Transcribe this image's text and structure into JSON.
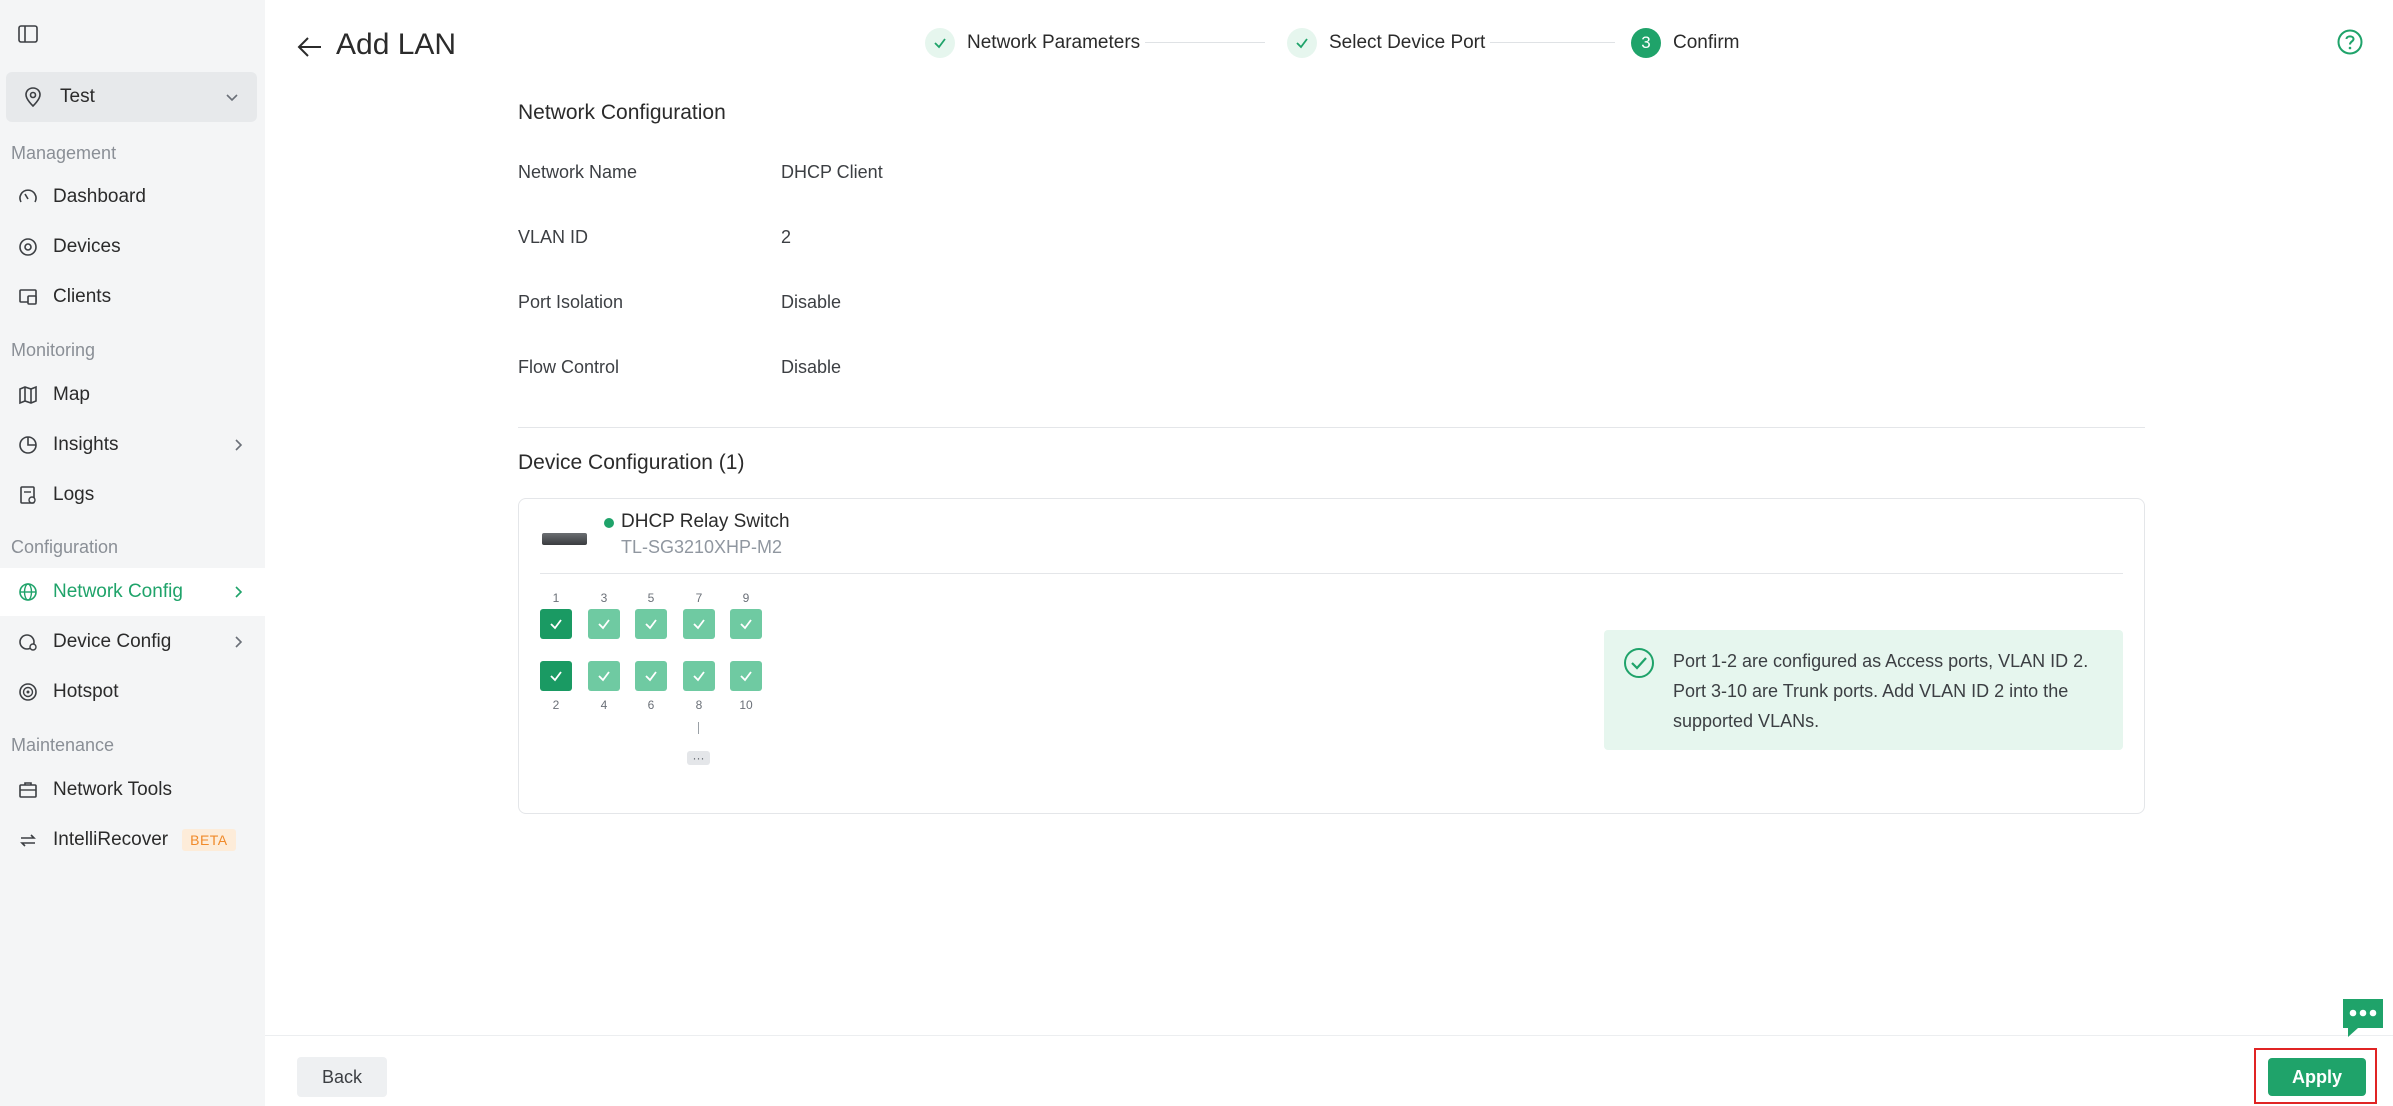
{
  "sidebar": {
    "site": {
      "name": "Test"
    },
    "sections": {
      "management": "Management",
      "monitoring": "Monitoring",
      "configuration": "Configuration",
      "maintenance": "Maintenance"
    },
    "items": {
      "dashboard": "Dashboard",
      "devices": "Devices",
      "clients": "Clients",
      "map": "Map",
      "insights": "Insights",
      "logs": "Logs",
      "network_config": "Network Config",
      "device_config": "Device Config",
      "hotspot": "Hotspot",
      "network_tools": "Network Tools",
      "intellirecover": "IntelliRecover",
      "beta_badge": "BETA"
    },
    "active_item": "Network Config"
  },
  "header": {
    "title": "Add LAN"
  },
  "stepper": {
    "steps": [
      {
        "label": "Network Parameters",
        "state": "done"
      },
      {
        "label": "Select Device Port",
        "state": "done"
      },
      {
        "label": "Confirm",
        "state": "current",
        "number": "3"
      }
    ]
  },
  "network_configuration": {
    "heading": "Network Configuration",
    "fields": [
      {
        "label": "Network Name",
        "value": "DHCP Client"
      },
      {
        "label": "VLAN ID",
        "value": "2"
      },
      {
        "label": "Port Isolation",
        "value": "Disable"
      },
      {
        "label": "Flow Control",
        "value": "Disable"
      }
    ]
  },
  "device_configuration": {
    "heading": "Device Configuration (1)",
    "device": {
      "name": "DHCP Relay Switch",
      "model": "TL-SG3210XHP-M2",
      "status": "online"
    },
    "ports": {
      "top_row": [
        "1",
        "3",
        "5",
        "7",
        "9"
      ],
      "bottom_row": [
        "2",
        "4",
        "6",
        "8",
        "10"
      ],
      "access_ports": [
        "1",
        "2"
      ],
      "trunk_ports": [
        "3",
        "4",
        "5",
        "6",
        "7",
        "8",
        "9",
        "10"
      ],
      "more_label": "···"
    },
    "info_message": "Port 1-2 are configured as Access ports, VLAN ID 2. Port 3-10 are Trunk ports. Add VLAN ID 2 into the supported VLANs."
  },
  "footer": {
    "back_label": "Back",
    "apply_label": "Apply"
  },
  "colors": {
    "accent": "#1fa36a",
    "access_port": "#1a9a63",
    "trunk_port": "#6fcaa2",
    "info_bg": "#e6f6ee",
    "highlight_frame": "#e02424"
  },
  "icons": {
    "collapse": "sidebar-collapse-icon",
    "site": "location-pin-icon",
    "help": "help-circle-icon",
    "chat": "chat-bubble-icon"
  }
}
